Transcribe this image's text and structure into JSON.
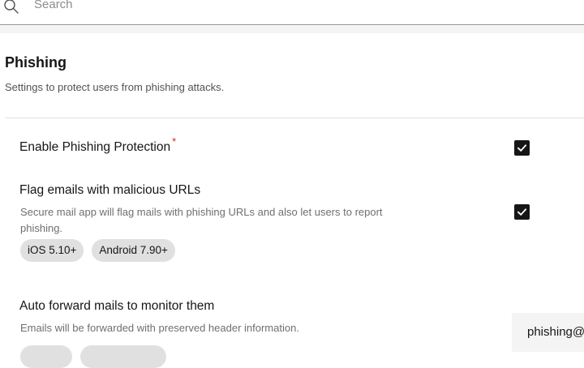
{
  "search": {
    "placeholder": "Search",
    "icon": "search-icon"
  },
  "section": {
    "title": "Phishing",
    "description": "Settings to protect users from phishing attacks."
  },
  "settings": [
    {
      "title": "Enable Phishing Protection",
      "required": true,
      "required_mark": "*",
      "checked": true
    },
    {
      "title": "Flag emails with malicious URLs",
      "description": "Secure mail app will flag mails with phishing URLs and also let users to report phishing.",
      "tags": [
        "iOS 5.10+",
        "Android 7.90+"
      ],
      "checked": true
    },
    {
      "title": "Auto forward mails to monitor them",
      "description": "Emails will be forwarded with preserved header information.",
      "email_value": "phishing@"
    }
  ],
  "colors": {
    "required": "#da1e28",
    "checkbox": "#161616",
    "tag_background": "#e0e0e0"
  }
}
